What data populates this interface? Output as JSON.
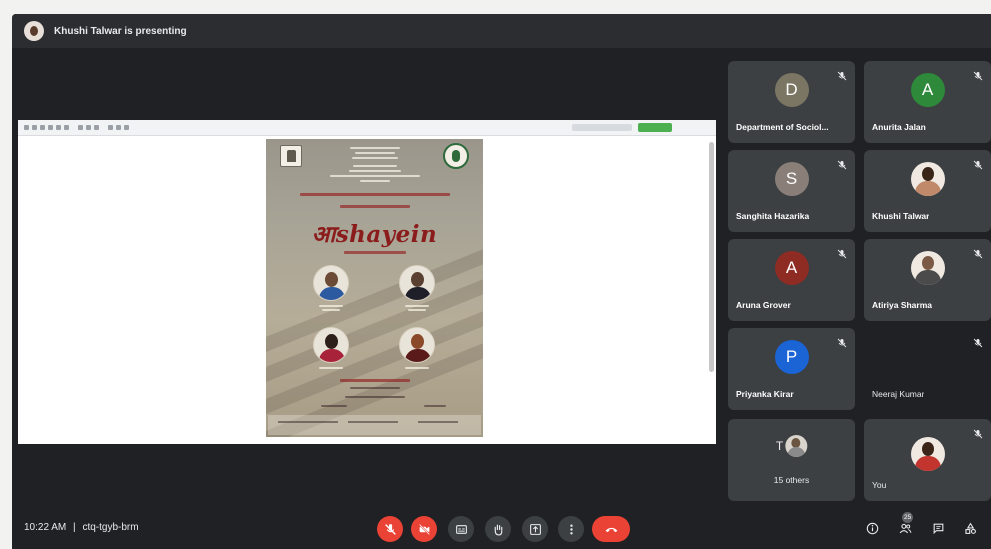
{
  "presenting": {
    "text": "Khushi Talwar is presenting"
  },
  "poster": {
    "title": "आshayein"
  },
  "participants": [
    {
      "name": "Department of Sociol...",
      "initial": "D",
      "color": "#7b7564",
      "muted": true,
      "type": "letter"
    },
    {
      "name": "Anurita Jalan",
      "initial": "A",
      "color": "#2e8a3a",
      "muted": true,
      "type": "letter"
    },
    {
      "name": "Sanghita Hazarika",
      "initial": "S",
      "color": "#8a7e78",
      "muted": true,
      "type": "letter"
    },
    {
      "name": "Khushi Talwar",
      "muted": true,
      "type": "photo"
    },
    {
      "name": "Aruna Grover",
      "initial": "A",
      "color": "#8e2b22",
      "muted": true,
      "type": "letter"
    },
    {
      "name": "Atiriya Sharma",
      "muted": true,
      "type": "photo"
    },
    {
      "name": "Priyanka Kirar",
      "initial": "P",
      "color": "#1a64d6",
      "muted": true,
      "type": "letter"
    },
    {
      "name": "Neeraj Kumar",
      "muted": true,
      "type": "none"
    },
    {
      "name": "15 others",
      "initial": "T",
      "muted": false,
      "type": "others"
    },
    {
      "name": "You",
      "muted": true,
      "type": "photo"
    }
  ],
  "bottom_bar": {
    "time": "10:22 AM",
    "separator": "|",
    "meeting_code": "ctq-tgyb-brm",
    "people_count": "25"
  },
  "colors": {
    "accent_red": "#ea4335",
    "control_grey": "#3c4043",
    "background": "#1f2124"
  }
}
